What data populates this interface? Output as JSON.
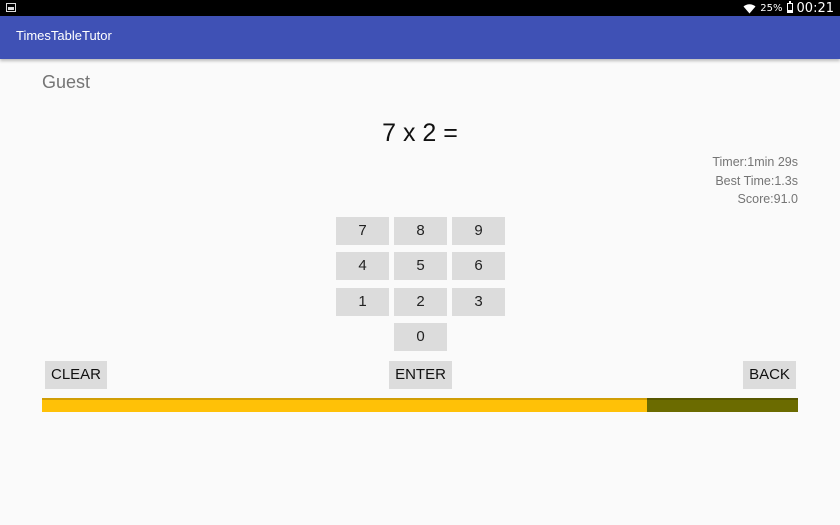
{
  "status_bar": {
    "battery": "25%",
    "time": "00:21"
  },
  "app": {
    "title": "TimesTableTutor",
    "brand_color": "#3f51b5"
  },
  "user": {
    "name": "Guest"
  },
  "question": {
    "text": "7 x 2 ="
  },
  "stats": {
    "timer": "Timer:1min 29s",
    "best_time": "Best Time:1.3s",
    "score": "Score:91.0"
  },
  "keypad": {
    "keys": [
      "7",
      "8",
      "9",
      "4",
      "5",
      "6",
      "1",
      "2",
      "3",
      "0"
    ]
  },
  "actions": {
    "clear": "CLEAR",
    "enter": "ENTER",
    "back": "BACK"
  },
  "progress": {
    "fraction": 0.8
  }
}
